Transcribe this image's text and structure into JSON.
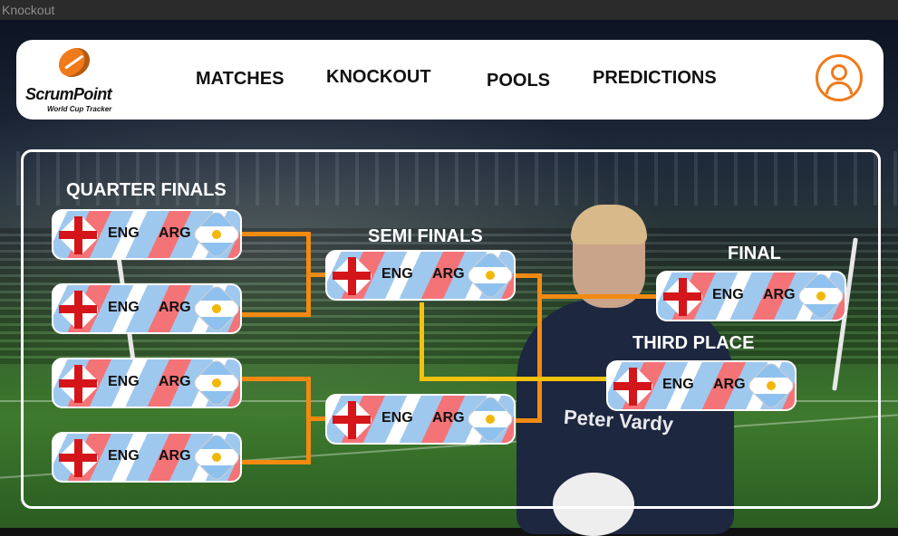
{
  "window": {
    "title": "Knockout"
  },
  "header": {
    "logo": {
      "name": "ScrumPoint",
      "tagline": "World Cup Tracker"
    },
    "nav": [
      "MATCHES",
      "KNOCKOUT",
      "POOLS",
      "PREDICTIONS"
    ],
    "profile_icon": "user-circle-icon"
  },
  "bracket": {
    "stages": {
      "quarter": "QUARTER FINALS",
      "semi": "SEMI FINALS",
      "final": "FINAL",
      "third": "THIRD PLACE"
    },
    "matches": {
      "qf1": {
        "home": "ENG",
        "away": "ARG"
      },
      "qf2": {
        "home": "ENG",
        "away": "ARG"
      },
      "qf3": {
        "home": "ENG",
        "away": "ARG"
      },
      "qf4": {
        "home": "ENG",
        "away": "ARG"
      },
      "sf1": {
        "home": "ENG",
        "away": "ARG"
      },
      "sf2": {
        "home": "ENG",
        "away": "ARG"
      },
      "final": {
        "home": "ENG",
        "away": "ARG"
      },
      "third": {
        "home": "ENG",
        "away": "ARG"
      }
    },
    "background_text": "Peter Vardy"
  },
  "colors": {
    "accent": "#f07a1a",
    "connector": "#f28a12",
    "third_place_connector": "#f2c20c",
    "stripe_red": "#f47377",
    "stripe_blue": "#9fc8ef"
  }
}
